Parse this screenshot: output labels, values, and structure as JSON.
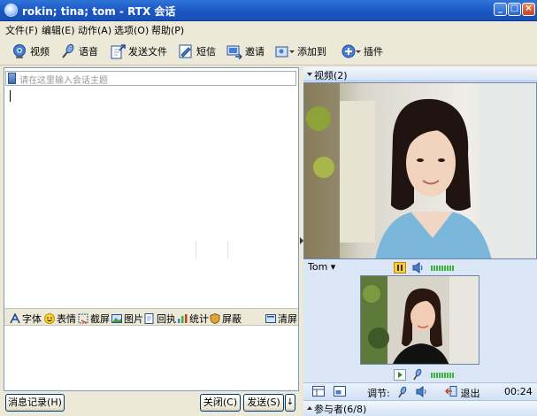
{
  "window": {
    "title": "rokin; tina; tom - RTX 会话"
  },
  "menu": [
    "文件(F)",
    "编辑(E)",
    "动作(A)",
    "选项(O)",
    "帮助(P)"
  ],
  "toolbar": {
    "video": "视频",
    "voice": "语音",
    "send_file": "发送文件",
    "sms": "短信",
    "invite": "邀请",
    "add_to": "添加到",
    "plugin": "插件"
  },
  "chat": {
    "subject_placeholder": "请在这里输入会话主题"
  },
  "format_bar": {
    "font": "字体",
    "emoticon": "表情",
    "screenshot": "截屏",
    "image": "图片",
    "receipt": "回执",
    "stats": "统计",
    "shield": "屏蔽",
    "clear": "清屏"
  },
  "bottom": {
    "history": "消息记录(H)",
    "close": "关闭(C)",
    "send": "发送(S)"
  },
  "video_panel": {
    "header": "视频(2)",
    "remote_name": "Tom",
    "adjust": "调节:",
    "exit": "退出",
    "timer": "00:24",
    "participants": "参与者(6/8)"
  },
  "colors": {
    "title_blue": "#1a57c2",
    "panel_blue": "#dbe7f6",
    "level_green": "#3db33d"
  }
}
